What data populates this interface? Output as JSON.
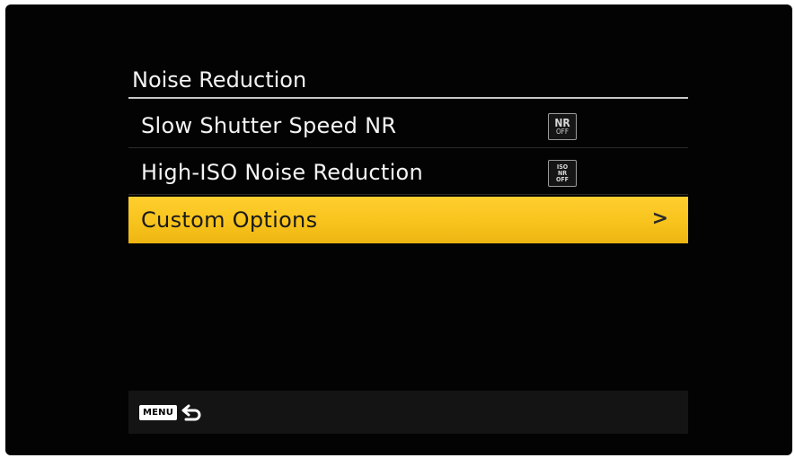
{
  "menu": {
    "title": "Noise Reduction",
    "items": [
      {
        "label": "Slow Shutter Speed NR",
        "icon": "nr-off-icon",
        "icon_lines": [
          "NR",
          "OFF"
        ]
      },
      {
        "label": "High-ISO Noise Reduction",
        "icon": "iso-nr-off-icon",
        "icon_lines": [
          "ISO",
          "NR",
          "OFF"
        ]
      },
      {
        "label": "Custom Options",
        "icon": "chevron-right-icon",
        "chevron": ">"
      }
    ]
  },
  "footer": {
    "menu_button": "MENU",
    "back_icon": "back-arrow-icon"
  },
  "colors": {
    "highlight": "#f7c21b",
    "background": "#030303",
    "text": "#f4f4f4"
  }
}
